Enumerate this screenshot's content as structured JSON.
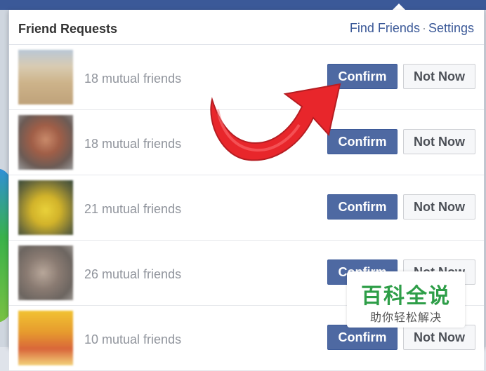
{
  "header": {
    "title": "Friend Requests",
    "find_friends_label": "Find Friends",
    "separator": "·",
    "settings_label": "Settings"
  },
  "requests": [
    {
      "mutual": "18 mutual friends",
      "confirm_label": "Confirm",
      "not_now_label": "Not Now"
    },
    {
      "mutual": "18 mutual friends",
      "confirm_label": "Confirm",
      "not_now_label": "Not Now"
    },
    {
      "mutual": "21 mutual friends",
      "confirm_label": "Confirm",
      "not_now_label": "Not Now"
    },
    {
      "mutual": "26 mutual friends",
      "confirm_label": "Confirm",
      "not_now_label": "Not Now"
    },
    {
      "mutual": "10 mutual friends",
      "confirm_label": "Confirm",
      "not_now_label": "Not Now"
    }
  ],
  "annotation": {
    "icon": "red-curved-arrow-icon",
    "color": "#e8262b"
  },
  "watermark": {
    "title": "百科全说",
    "subtitle": "助你轻松解决"
  },
  "colors": {
    "brand": "#3b5998",
    "confirm": "#4e69a2"
  }
}
